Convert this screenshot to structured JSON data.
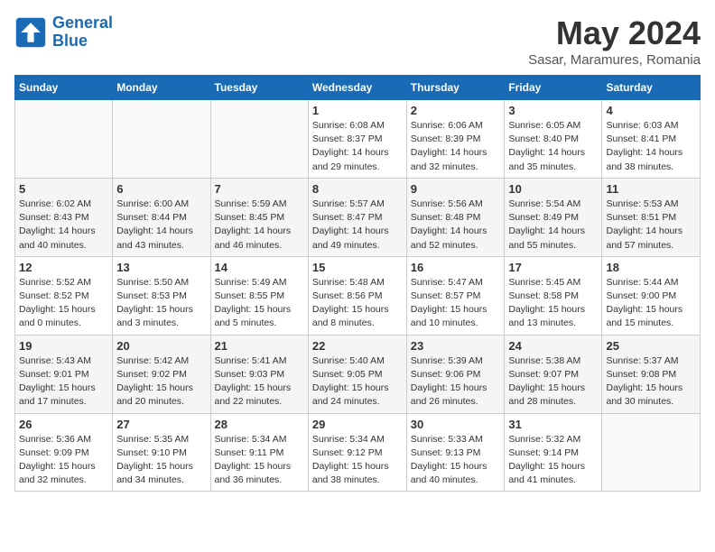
{
  "logo": {
    "line1": "General",
    "line2": "Blue"
  },
  "title": "May 2024",
  "subtitle": "Sasar, Maramures, Romania",
  "weekdays": [
    "Sunday",
    "Monday",
    "Tuesday",
    "Wednesday",
    "Thursday",
    "Friday",
    "Saturday"
  ],
  "weeks": [
    [
      {
        "day": "",
        "info": ""
      },
      {
        "day": "",
        "info": ""
      },
      {
        "day": "",
        "info": ""
      },
      {
        "day": "1",
        "info": "Sunrise: 6:08 AM\nSunset: 8:37 PM\nDaylight: 14 hours\nand 29 minutes."
      },
      {
        "day": "2",
        "info": "Sunrise: 6:06 AM\nSunset: 8:39 PM\nDaylight: 14 hours\nand 32 minutes."
      },
      {
        "day": "3",
        "info": "Sunrise: 6:05 AM\nSunset: 8:40 PM\nDaylight: 14 hours\nand 35 minutes."
      },
      {
        "day": "4",
        "info": "Sunrise: 6:03 AM\nSunset: 8:41 PM\nDaylight: 14 hours\nand 38 minutes."
      }
    ],
    [
      {
        "day": "5",
        "info": "Sunrise: 6:02 AM\nSunset: 8:43 PM\nDaylight: 14 hours\nand 40 minutes."
      },
      {
        "day": "6",
        "info": "Sunrise: 6:00 AM\nSunset: 8:44 PM\nDaylight: 14 hours\nand 43 minutes."
      },
      {
        "day": "7",
        "info": "Sunrise: 5:59 AM\nSunset: 8:45 PM\nDaylight: 14 hours\nand 46 minutes."
      },
      {
        "day": "8",
        "info": "Sunrise: 5:57 AM\nSunset: 8:47 PM\nDaylight: 14 hours\nand 49 minutes."
      },
      {
        "day": "9",
        "info": "Sunrise: 5:56 AM\nSunset: 8:48 PM\nDaylight: 14 hours\nand 52 minutes."
      },
      {
        "day": "10",
        "info": "Sunrise: 5:54 AM\nSunset: 8:49 PM\nDaylight: 14 hours\nand 55 minutes."
      },
      {
        "day": "11",
        "info": "Sunrise: 5:53 AM\nSunset: 8:51 PM\nDaylight: 14 hours\nand 57 minutes."
      }
    ],
    [
      {
        "day": "12",
        "info": "Sunrise: 5:52 AM\nSunset: 8:52 PM\nDaylight: 15 hours\nand 0 minutes."
      },
      {
        "day": "13",
        "info": "Sunrise: 5:50 AM\nSunset: 8:53 PM\nDaylight: 15 hours\nand 3 minutes."
      },
      {
        "day": "14",
        "info": "Sunrise: 5:49 AM\nSunset: 8:55 PM\nDaylight: 15 hours\nand 5 minutes."
      },
      {
        "day": "15",
        "info": "Sunrise: 5:48 AM\nSunset: 8:56 PM\nDaylight: 15 hours\nand 8 minutes."
      },
      {
        "day": "16",
        "info": "Sunrise: 5:47 AM\nSunset: 8:57 PM\nDaylight: 15 hours\nand 10 minutes."
      },
      {
        "day": "17",
        "info": "Sunrise: 5:45 AM\nSunset: 8:58 PM\nDaylight: 15 hours\nand 13 minutes."
      },
      {
        "day": "18",
        "info": "Sunrise: 5:44 AM\nSunset: 9:00 PM\nDaylight: 15 hours\nand 15 minutes."
      }
    ],
    [
      {
        "day": "19",
        "info": "Sunrise: 5:43 AM\nSunset: 9:01 PM\nDaylight: 15 hours\nand 17 minutes."
      },
      {
        "day": "20",
        "info": "Sunrise: 5:42 AM\nSunset: 9:02 PM\nDaylight: 15 hours\nand 20 minutes."
      },
      {
        "day": "21",
        "info": "Sunrise: 5:41 AM\nSunset: 9:03 PM\nDaylight: 15 hours\nand 22 minutes."
      },
      {
        "day": "22",
        "info": "Sunrise: 5:40 AM\nSunset: 9:05 PM\nDaylight: 15 hours\nand 24 minutes."
      },
      {
        "day": "23",
        "info": "Sunrise: 5:39 AM\nSunset: 9:06 PM\nDaylight: 15 hours\nand 26 minutes."
      },
      {
        "day": "24",
        "info": "Sunrise: 5:38 AM\nSunset: 9:07 PM\nDaylight: 15 hours\nand 28 minutes."
      },
      {
        "day": "25",
        "info": "Sunrise: 5:37 AM\nSunset: 9:08 PM\nDaylight: 15 hours\nand 30 minutes."
      }
    ],
    [
      {
        "day": "26",
        "info": "Sunrise: 5:36 AM\nSunset: 9:09 PM\nDaylight: 15 hours\nand 32 minutes."
      },
      {
        "day": "27",
        "info": "Sunrise: 5:35 AM\nSunset: 9:10 PM\nDaylight: 15 hours\nand 34 minutes."
      },
      {
        "day": "28",
        "info": "Sunrise: 5:34 AM\nSunset: 9:11 PM\nDaylight: 15 hours\nand 36 minutes."
      },
      {
        "day": "29",
        "info": "Sunrise: 5:34 AM\nSunset: 9:12 PM\nDaylight: 15 hours\nand 38 minutes."
      },
      {
        "day": "30",
        "info": "Sunrise: 5:33 AM\nSunset: 9:13 PM\nDaylight: 15 hours\nand 40 minutes."
      },
      {
        "day": "31",
        "info": "Sunrise: 5:32 AM\nSunset: 9:14 PM\nDaylight: 15 hours\nand 41 minutes."
      },
      {
        "day": "",
        "info": ""
      }
    ]
  ]
}
